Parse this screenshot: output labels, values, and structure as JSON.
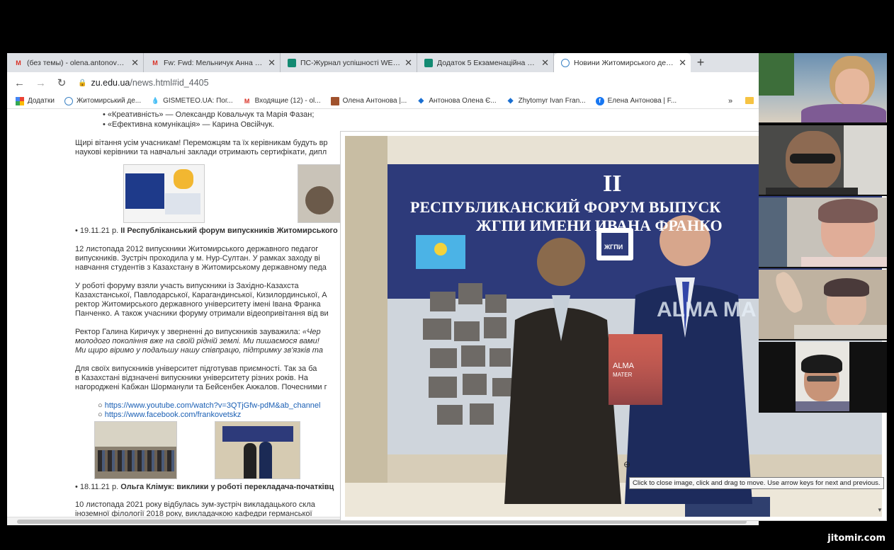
{
  "tabs": [
    {
      "icon": "gmail-icon",
      "title": "(без темы) - olena.antonova2015@...",
      "active": false
    },
    {
      "icon": "gmail-icon",
      "title": "Fw: Fwd: Мельничук Анна - olena...",
      "active": false
    },
    {
      "icon": "sheet-icon",
      "title": "ПС-Журнал успішності WEB v.3...",
      "active": false
    },
    {
      "icon": "sheet-icon",
      "title": "Додаток 5 Екзаменаційна відомість",
      "active": false
    },
    {
      "icon": "globe-icon",
      "title": "Новини Житомирського держав...",
      "active": true
    }
  ],
  "address": {
    "domain": "zu.edu.ua",
    "path": "/news.html#id_4405"
  },
  "bookmarks": [
    {
      "icon": "apps-icon",
      "label": "Додатки"
    },
    {
      "icon": "globe-icon",
      "label": "Житомирський де..."
    },
    {
      "icon": "drop-icon",
      "label": "GISMETEO.UA: Пог..."
    },
    {
      "icon": "gmail-icon",
      "label": "Входящие (12) - ol..."
    },
    {
      "icon": "book-icon",
      "label": "Олена Антонова |..."
    },
    {
      "icon": "ms-icon",
      "label": "Антонова Олена Є..."
    },
    {
      "icon": "ms-icon",
      "label": "Zhytomyr Ivan Fran..."
    },
    {
      "icon": "facebook-icon",
      "label": "Елена Антонова | F..."
    }
  ],
  "bookmarks_more": "»",
  "article": {
    "li1": "«Креативність» — Олександр Ковальчук та Марія Фазан;",
    "li2": "«Ефективна комунікація» — Карина Овсійчук.",
    "congrats1": "Щирі вітання усім учасникам! Переможцям та їх керівникам будуть вр",
    "congrats2": "наукові керівники та навчальні заклади отримають сертифікати, дипл",
    "news1_date": "19.11.21 р.",
    "news1_title": "ІІ Республіканський форум випускників Житомирського",
    "p1": "12 листопада 2012 випускники Житомирського державного педагог",
    "p2": "випускників. Зустріч проходила у м. Нур-Султан. У рамках заходу ві",
    "p3": "навчання студентів з Казахстану в Житомирському державному педа",
    "p4": "У роботі форуму взяли участь випускники із Західно-Казахста",
    "p5": "Казахстанської, Павлодарської, Карагандинської, Кизилординської, А",
    "p6": "ректор Житомирського державного університету імені Івана Франка",
    "p7": "Панченко. А також учасники форуму отримали відеопривітання від ви",
    "p8": "Ректор Галина Киричук у зверненні до випускників зауважила:",
    "p8i": "«Чер",
    "p9": "молодого покоління вже на своїй рідній землі. Ми пишаємося вами!",
    "p10": "Ми щиро віримо у подальшу нашу співпрацю, підтримку зв'язків та",
    "p11": "Для своїх випускників університет підготував приємності. Так за ба",
    "p12": "в Казахстані відзначені випускники університету різних років. На",
    "p13": "нагороджені Кабжан Шорманули та Бейсенбек Акжалов. Почесними г",
    "link1": "https://www.youtube.com/watch?v=3QTjGfw-pdM&ab_channel",
    "link2": "https://www.facebook.com/frankovetskz",
    "news2_date": "18.11.21 р.",
    "news2_title": "Ольга Клімук: виклики у роботі перекладача-початківц",
    "p14": "10 листопада 2021 року відбулась зум-зустріч викладацького скла",
    "p15": "іноземної філології 2018 року, викладачкою кафедри германської"
  },
  "photo": {
    "banner_line0": "II",
    "banner_line1": "РЕСПУБЛИКАНСКИЙ ФОРУМ ВЫПУСК",
    "banner_line2": "ЖГПИ ИМЕНИ ИВАНА ФРАНКО",
    "emblem": "ЖГПИ",
    "book_title1": "ALMA",
    "book_title2": "MATER",
    "backdrop_text": "ALMA MA"
  },
  "tooltip": "Click to close image, click and drag to move. Use arrow keys for next and previous.",
  "watermark": "jitomir.com",
  "colors": {
    "banner": "#2d3a7a",
    "banner_text": "#ffffff",
    "kz_flag": "#4bb3e6",
    "link": "#1a5fb4"
  }
}
